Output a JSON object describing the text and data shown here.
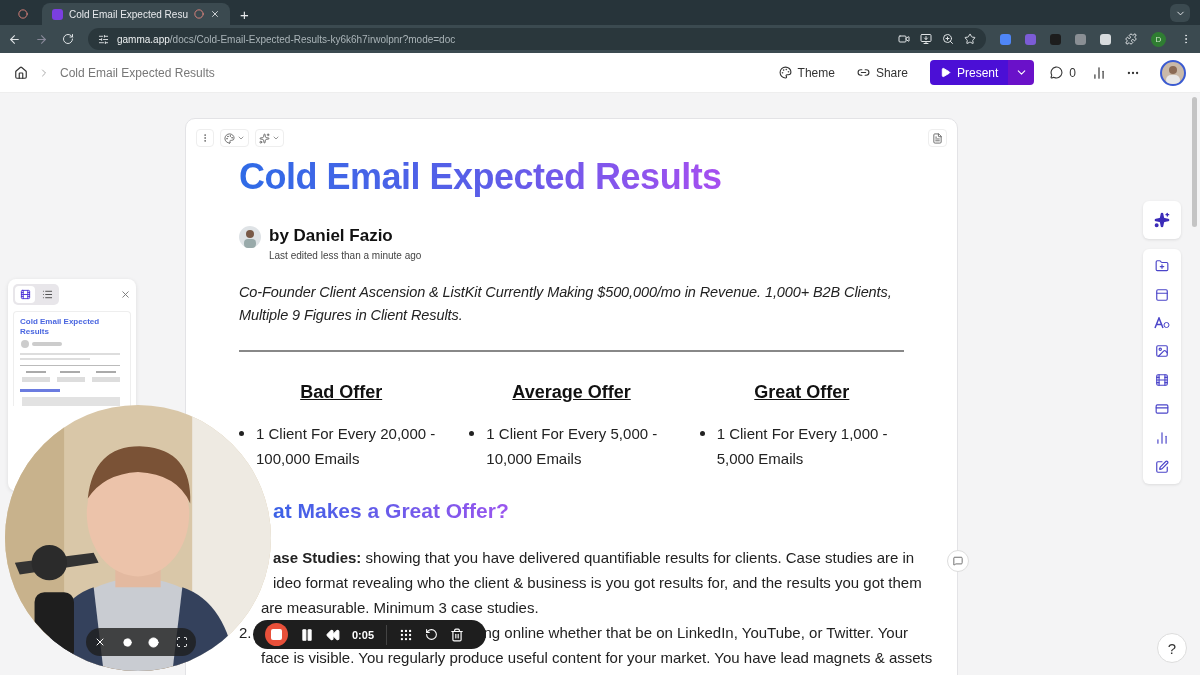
{
  "browser": {
    "tabs": [
      {
        "kind": "pinned",
        "selected": false
      },
      {
        "kind": "page",
        "title": "Cold Email Expected Resu",
        "selected": true
      }
    ],
    "new_tab": "+",
    "url": {
      "host": "gamma.app",
      "path": "/docs/Cold-Email-Expected-Results-ky6k6h7irwolpnr?mode=doc"
    },
    "profile": "D"
  },
  "header": {
    "breadcrumb": "Cold Email Expected Results",
    "theme": "Theme",
    "share": "Share",
    "present": "Present",
    "comments": "0"
  },
  "doc": {
    "title": "Cold Email Expected Results",
    "author": "by Daniel Fazio",
    "edited": "Last edited less than a minute ago",
    "tagline": "Co-Founder Client Ascension & ListKit Currently Making $500,000/mo in Revenue. 1,000+ B2B Clients, Multiple 9 Figures in Client Results.",
    "offers": [
      {
        "heading": "Bad Offer",
        "bullet": "1 Client For Every 20,000 - 100,000 Emails"
      },
      {
        "heading": "Average Offer",
        "bullet": "1 Client For Every 5,000 - 10,000 Emails"
      },
      {
        "heading": "Great Offer",
        "bullet": "1 Client For Every 1,000 - 5,000 Emails"
      }
    ],
    "section_heading": "at Makes a Great Offer?",
    "items": [
      {
        "lines": [
          "**ase Studies:** showing that you have delivered quantifiable results for clients. Case studies are in",
          "ideo format revealing who the client & business is you got results for, and the results you got them",
          "are measurable. Minimum 3 case studies."
        ]
      },
      {
        "marker": "2.",
        "lines": [
          "ng online whether that be on LinkedIn, YouTube, or Twitter. Your",
          "face is visible. You regularly produce useful content for your market. You have lead magnets & assets"
        ]
      }
    ]
  },
  "thumbnails": {
    "views": [
      {
        "kind": "cards",
        "selected": true
      },
      {
        "kind": "list",
        "selected": false
      }
    ],
    "title": "Cold Email Expected Results"
  },
  "recorder": {
    "time": "0:05"
  },
  "help": "?"
}
